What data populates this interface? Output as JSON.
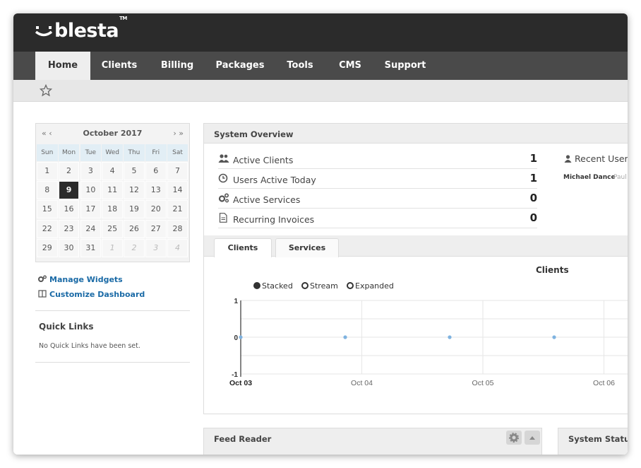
{
  "app": {
    "logo_text": "blesta",
    "logo_tm": "TM"
  },
  "nav": {
    "tabs": [
      {
        "label": "Home",
        "active": true
      },
      {
        "label": "Clients"
      },
      {
        "label": "Billing"
      },
      {
        "label": "Packages"
      },
      {
        "label": "Tools"
      },
      {
        "label": "CMS"
      },
      {
        "label": "Support"
      }
    ]
  },
  "calendar": {
    "prev": "« ‹",
    "next": "› »",
    "month": "October 2017",
    "dow": [
      "Sun",
      "Mon",
      "Tue",
      "Wed",
      "Thu",
      "Fri",
      "Sat"
    ],
    "weeks": [
      [
        "1",
        "2",
        "3",
        "4",
        "5",
        "6",
        "7"
      ],
      [
        "8",
        "9",
        "10",
        "11",
        "12",
        "13",
        "14"
      ],
      [
        "15",
        "16",
        "17",
        "18",
        "19",
        "20",
        "21"
      ],
      [
        "22",
        "23",
        "24",
        "25",
        "26",
        "27",
        "28"
      ],
      [
        "29",
        "30",
        "31",
        "1",
        "2",
        "3",
        "4"
      ]
    ],
    "today": "9"
  },
  "widgets": {
    "manage": "Manage Widgets",
    "customize": "Customize Dashboard"
  },
  "quick_links": {
    "title": "Quick Links",
    "empty": "No Quick Links have been set."
  },
  "overview": {
    "title": "System Overview",
    "stats": [
      {
        "label": "Active Clients",
        "value": "1",
        "icon": "users-icon"
      },
      {
        "label": "Users Active Today",
        "value": "1",
        "icon": "clock-icon"
      },
      {
        "label": "Active Services",
        "value": "0",
        "icon": "gears-icon"
      },
      {
        "label": "Recurring Invoices",
        "value": "0",
        "icon": "document-icon"
      }
    ],
    "recent_users": "Recent Users",
    "recent_user_1": "Michael Dance",
    "recent_user_2": "Paul",
    "tabs": [
      "Clients",
      "Services"
    ],
    "chart_title": "Clients",
    "modes": [
      "Stacked",
      "Stream",
      "Expanded"
    ],
    "active_mode": "Stacked"
  },
  "chart_data": {
    "type": "line",
    "title": "Clients",
    "x": [
      "Oct 03",
      "Oct 04",
      "Oct 05",
      "Oct 06"
    ],
    "series": [
      {
        "values": [
          0,
          0,
          0,
          0
        ]
      }
    ],
    "ylim": [
      -1,
      1
    ],
    "yticks": [
      "1",
      "0",
      "-1"
    ],
    "color": "#7fb3e0"
  },
  "bottom": {
    "feed": "Feed Reader",
    "status": "System Status"
  },
  "colors": {
    "topbar": "#2b2b2b",
    "nav": "#4a4a4a",
    "link": "#1a6aa6"
  }
}
